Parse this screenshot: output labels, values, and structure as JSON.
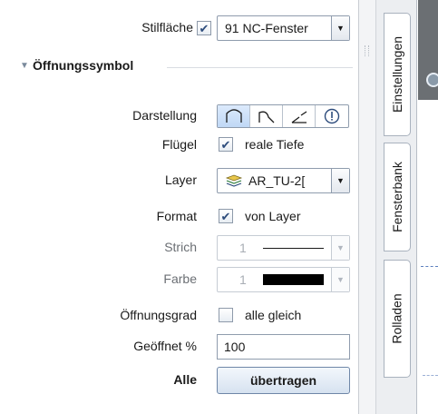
{
  "stilflaeche": {
    "label": "Stilfläche",
    "checked": true,
    "value": "91 NC-Fenster"
  },
  "section": {
    "title": "Öffnungssymbol"
  },
  "darstellung": {
    "label": "Darstellung",
    "options": [
      "swing-open-icon",
      "swing-half-icon",
      "swing-slanted-icon",
      "info-icon"
    ],
    "active_index": 0
  },
  "fluegel": {
    "label": "Flügel",
    "checked": true,
    "option": "reale Tiefe"
  },
  "layer": {
    "label": "Layer",
    "value": "AR_TU-2[",
    "icon": "layer-icon"
  },
  "format": {
    "label": "Format",
    "checked": true,
    "option": "von Layer"
  },
  "strich": {
    "label": "Strich",
    "value": "1"
  },
  "farbe": {
    "label": "Farbe",
    "value": "1",
    "swatch": "#000000"
  },
  "oeffnungsgrad": {
    "label": "Öffnungsgrad",
    "checked": false,
    "option": "alle gleich"
  },
  "geoeffnet": {
    "label": "Geöffnet %",
    "value": "100"
  },
  "alle": {
    "label": "Alle",
    "button": "übertragen"
  },
  "tabs": {
    "einstellungen": "Einstellungen",
    "fensterbank": "Fensterbank",
    "rolladen": "Rolladen"
  },
  "colors": {
    "accent": "#2d4c7c",
    "border": "#8f9cad"
  }
}
